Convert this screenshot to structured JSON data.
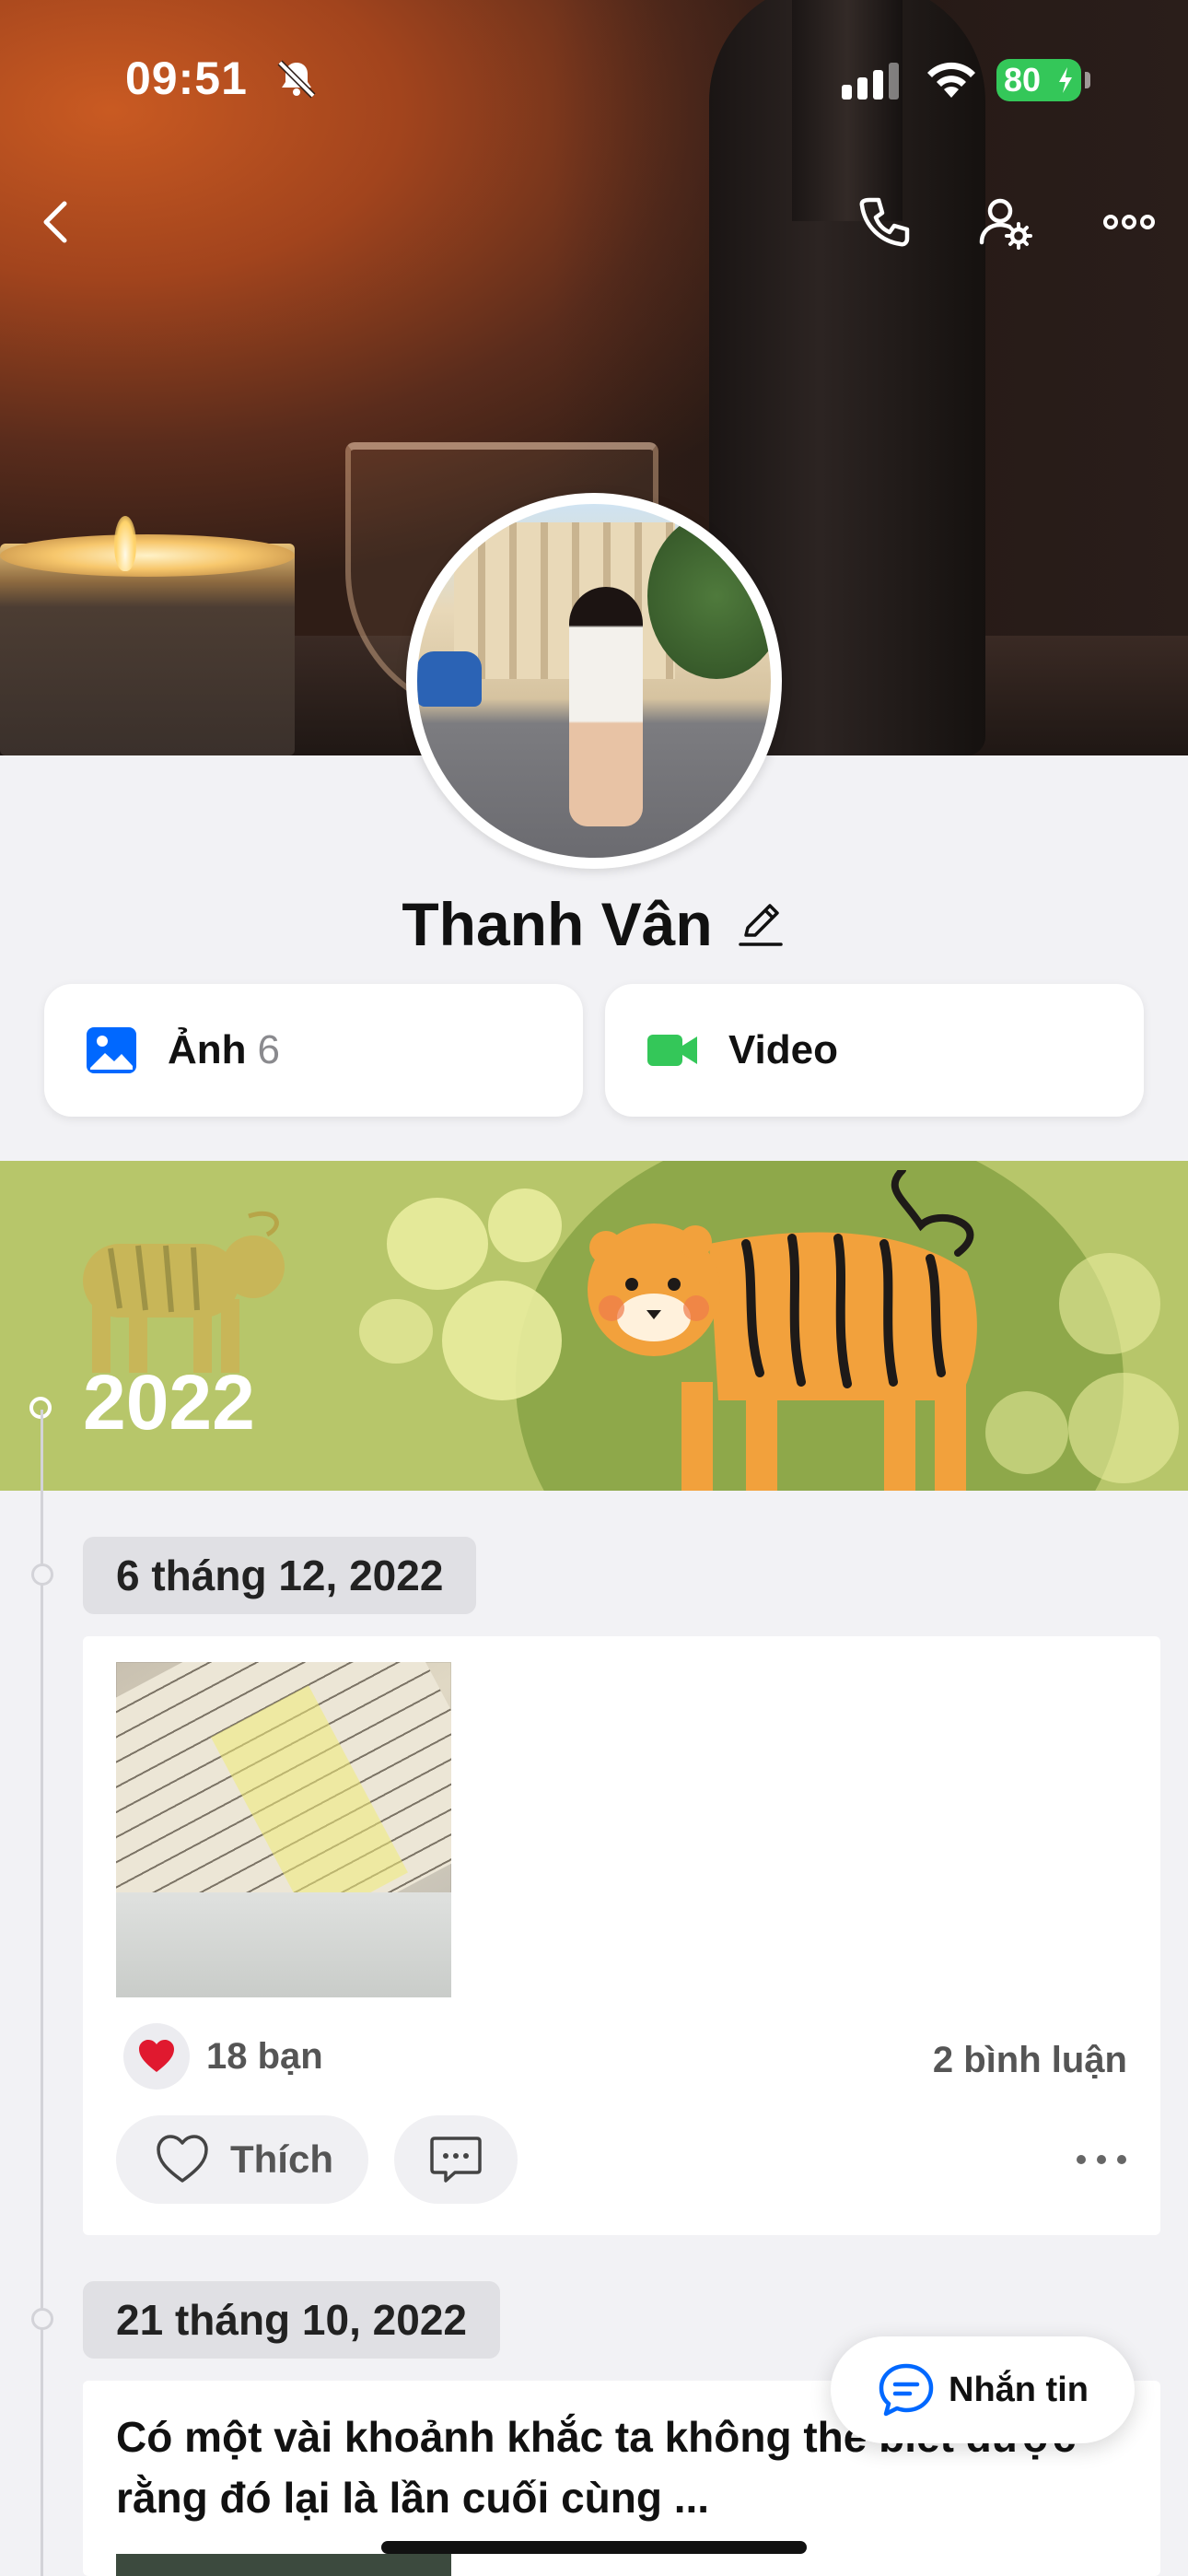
{
  "status_bar": {
    "time": "09:51",
    "battery_level": "80",
    "icons": [
      "bell-slash-icon",
      "cellular-signal-icon",
      "wifi-icon",
      "battery-charging-icon"
    ]
  },
  "header_actions": {
    "icons": [
      "back-chevron-icon",
      "phone-icon",
      "user-settings-icon",
      "more-horizontal-icon"
    ]
  },
  "profile": {
    "name": "Thanh Vân"
  },
  "media": {
    "photos_label": "Ảnh",
    "photos_count": "6",
    "video_label": "Video"
  },
  "timeline": {
    "year": "2022",
    "posts": [
      {
        "date": "6 tháng 12, 2022",
        "likes_text": "18 bạn",
        "comments_text": "2 bình luận",
        "like_button_label": "Thích"
      },
      {
        "date": "21 tháng 10, 2022",
        "text": "Có một vài khoảnh khắc ta không thể biết được rằng đó lại là lần cuối cùng ..."
      }
    ]
  },
  "message_button": {
    "label": "Nhắn tin"
  },
  "colors": {
    "accent_blue": "#0068ff",
    "video_green": "#34c759",
    "heart_red": "#e0192f",
    "banner_green": "#b7c66a"
  }
}
